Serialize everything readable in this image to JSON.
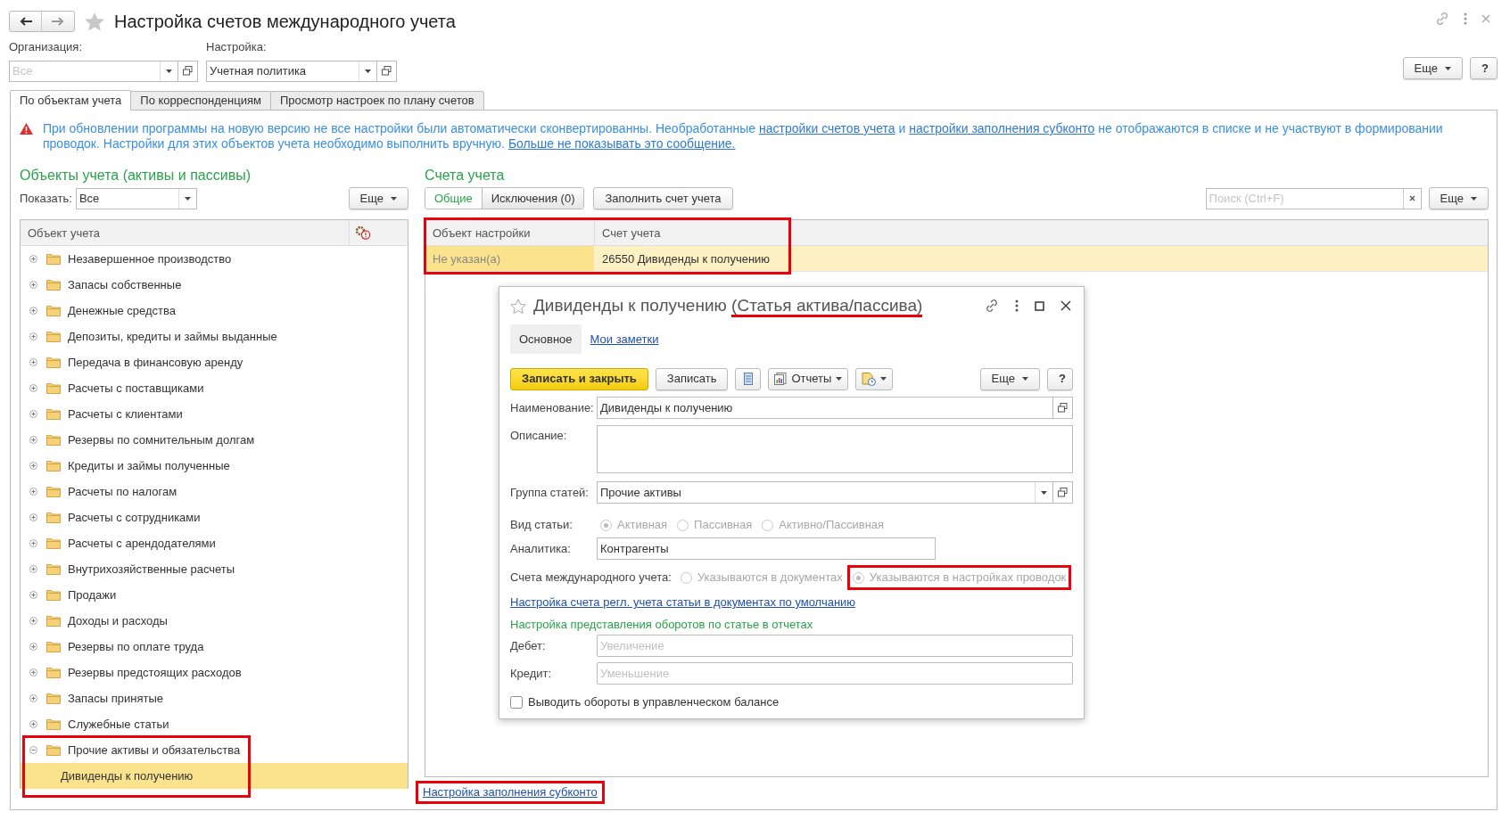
{
  "window": {
    "title": "Настройка счетов международного учета"
  },
  "filters": [
    {
      "label": "Организация:",
      "placeholder": "Все"
    },
    {
      "label": "Настройка:",
      "value": "Учетная политика"
    }
  ],
  "top_buttons": [
    {
      "kind": "more",
      "label": "Еще"
    },
    {
      "kind": "help",
      "label": "?"
    }
  ],
  "tabs": [
    {
      "label": "По объектам учета",
      "selected": true
    },
    {
      "label": "По корреспонденциям",
      "selected": false
    },
    {
      "label": "Просмотр настроек по плану счетов",
      "selected": false
    }
  ],
  "warning": [
    {
      "kind": "text",
      "text": "При обновлении программы на новую версию не все настройки были автоматически сконвертированны. Необработанные "
    },
    {
      "kind": "link",
      "text": "настройки счетов учета"
    },
    {
      "kind": "text",
      "text": " и "
    },
    {
      "kind": "link",
      "text": "настройки заполнения субконто"
    },
    {
      "kind": "text",
      "text": " не отображаются в списке и не участвуют в формировании проводок. Настройки для этих объектов учета необходимо выполнить вручную. "
    },
    {
      "kind": "link",
      "text": "Больше не показывать это сообщение."
    }
  ],
  "objects": {
    "title": "Объекты учета (активы и пассивы)",
    "show_label": "Показать:",
    "show_value": "Все",
    "more_button": "Еще",
    "column": "Объект учета",
    "tree": [
      {
        "label": "Незавершенное производство",
        "expanded": false,
        "highlighted": false
      },
      {
        "label": "Запасы собственные",
        "expanded": false,
        "highlighted": false
      },
      {
        "label": "Денежные средства",
        "expanded": false,
        "highlighted": false
      },
      {
        "label": "Депозиты, кредиты и займы выданные",
        "expanded": false,
        "highlighted": false
      },
      {
        "label": "Передача в финансовую аренду",
        "expanded": false,
        "highlighted": false
      },
      {
        "label": "Расчеты с поставщиками",
        "expanded": false,
        "highlighted": false
      },
      {
        "label": "Расчеты с клиентами",
        "expanded": false,
        "highlighted": false
      },
      {
        "label": "Резервы по сомнительным долгам",
        "expanded": false,
        "highlighted": false
      },
      {
        "label": "Кредиты и займы полученные",
        "expanded": false,
        "highlighted": false
      },
      {
        "label": "Расчеты по налогам",
        "expanded": false,
        "highlighted": false
      },
      {
        "label": "Расчеты с сотрудниками",
        "expanded": false,
        "highlighted": false
      },
      {
        "label": "Расчеты с арендодателями",
        "expanded": false,
        "highlighted": false
      },
      {
        "label": "Внутрихозяйственные расчеты",
        "expanded": false,
        "highlighted": false
      },
      {
        "label": "Продажи",
        "expanded": false,
        "highlighted": false
      },
      {
        "label": "Доходы и расходы",
        "expanded": false,
        "highlighted": false
      },
      {
        "label": "Резервы по оплате труда",
        "expanded": false,
        "highlighted": false
      },
      {
        "label": "Резервы предстоящих расходов",
        "expanded": false,
        "highlighted": false
      },
      {
        "label": "Запасы принятые",
        "expanded": false,
        "highlighted": false
      },
      {
        "label": "Служебные статьи",
        "expanded": false,
        "highlighted": false
      },
      {
        "label": "Прочие активы и обязательства",
        "expanded": true,
        "highlighted": true,
        "children": [
          {
            "label": "Дивиденды к получению",
            "selected": true
          }
        ]
      }
    ]
  },
  "accounts": {
    "title": "Счета учета",
    "segments": [
      {
        "label": "Общие",
        "selected": true
      },
      {
        "label": "Исключения (0)",
        "selected": false
      }
    ],
    "fill_button": "Заполнить счет учета",
    "search_placeholder": "Поиск (Ctrl+F)",
    "more_button": "Еще",
    "table": {
      "highlighted": true,
      "columns": [
        "Объект настройки",
        "Счет учета"
      ],
      "rows": [
        {
          "cells": [
            "Не указан(а)",
            "26550 Дивиденды к получению"
          ],
          "selected": true
        }
      ]
    },
    "link": {
      "text": "Настройка заполнения субконто",
      "highlighted": true
    }
  },
  "dialog": {
    "title": "Дивиденды к получению",
    "subtitle": "(Статья актива/пассива)",
    "subtitle_highlighted": true,
    "tabs": [
      {
        "label": "Основное",
        "selected": true
      },
      {
        "label": "Мои заметки",
        "selected": false
      }
    ],
    "buttons": [
      {
        "kind": "primary",
        "label": "Записать и закрыть"
      },
      {
        "kind": "plain",
        "label": "Записать"
      },
      {
        "kind": "list-icon"
      },
      {
        "kind": "reports",
        "label": "Отчеты"
      },
      {
        "kind": "tools-icon"
      },
      {
        "kind": "more",
        "label": "Еще"
      },
      {
        "kind": "help",
        "label": "?"
      }
    ],
    "fields": [
      {
        "kind": "text",
        "label": "Наименование:",
        "value": "Дивиденды к получению"
      },
      {
        "kind": "textarea",
        "label": "Описание:"
      },
      {
        "kind": "select",
        "label": "Группа статей:",
        "value": "Прочие активы"
      },
      {
        "kind": "radio",
        "label": "Вид статьи:",
        "disabled": true,
        "options": [
          {
            "label": "Активная",
            "selected": true,
            "highlighted": false
          },
          {
            "label": "Пассивная",
            "selected": false,
            "highlighted": false
          },
          {
            "label": "Активно/Пассивная",
            "selected": false,
            "highlighted": false
          }
        ]
      },
      {
        "kind": "short-text",
        "label": "Аналитика:",
        "value": "Контрагенты"
      },
      {
        "kind": "radio",
        "label": "Счета международного учета:",
        "disabled": true,
        "options": [
          {
            "label": "Указываются в документах",
            "selected": false,
            "highlighted": false
          },
          {
            "label": "Указываются в настройках проводок",
            "selected": true,
            "highlighted": true
          }
        ]
      },
      {
        "kind": "link",
        "label": "Настройка счета регл. учета статьи в документах по умолчанию"
      },
      {
        "kind": "section",
        "label": "Настройка представления оборотов по статье в отчетах"
      },
      {
        "kind": "text-placeholder",
        "label": "Дебет:",
        "placeholder": "Увеличение"
      },
      {
        "kind": "text-placeholder",
        "label": "Кредит:",
        "placeholder": "Уменьшение"
      },
      {
        "kind": "checkbox",
        "label": "Выводить обороты в управленческом балансе",
        "checked": false
      }
    ]
  }
}
